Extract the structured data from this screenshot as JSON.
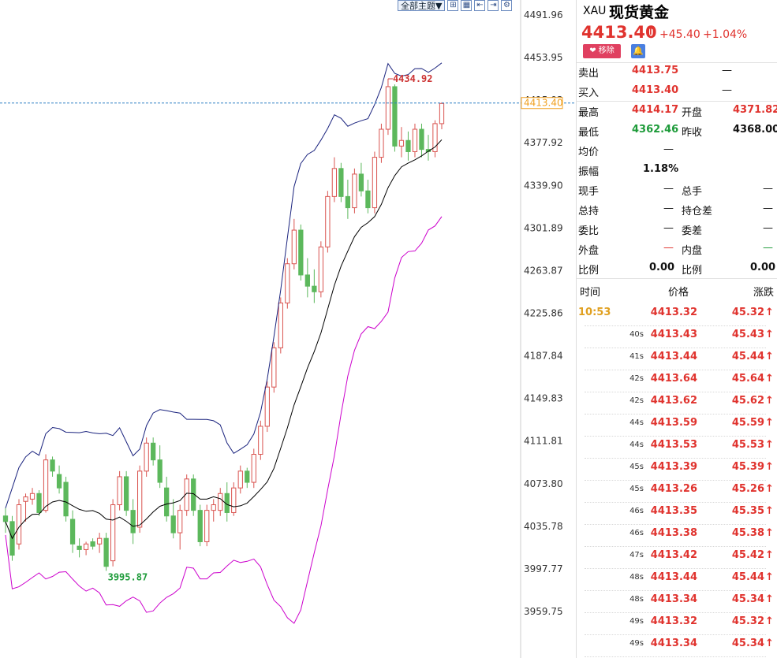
{
  "toolbar": {
    "theme_label": "全部主题▼",
    "icons": [
      "grid-icon",
      "table-icon",
      "first-page-icon",
      "last-page-icon",
      "settings-icon"
    ]
  },
  "header": {
    "code": "XAU",
    "name": "现货黄金",
    "price": "4413.40",
    "change": "+45.40",
    "change_pct": "+1.04%",
    "remove_label": "❤ 移除",
    "up_color": "#e0332e",
    "down_color": "#1e9b3a"
  },
  "quote": {
    "sell_label": "卖出",
    "sell": "4413.75",
    "sell_vol": "—",
    "buy_label": "买入",
    "buy": "4413.40",
    "buy_vol": "—",
    "high_label": "最高",
    "high": "4414.17",
    "open_label": "开盘",
    "open": "4371.82",
    "low_label": "最低",
    "low": "4362.46",
    "prev_label": "昨收",
    "prev": "4368.00",
    "avg_label": "均价",
    "avg": "—",
    "amp_label": "振幅",
    "amp": "1.18%",
    "cur_vol_label": "现手",
    "cur_vol": "—",
    "total_vol_label": "总手",
    "total_vol": "—",
    "oi_label": "总持",
    "oi": "—",
    "oi_diff_label": "持仓差",
    "oi_diff": "—",
    "ratio_label": "委比",
    "ratio": "—",
    "diff_label": "委差",
    "diff": "—",
    "outer_label": "外盘",
    "outer": "—",
    "inner_label": "内盘",
    "inner": "—",
    "ratio1_label": "比例",
    "ratio1": "0.00",
    "ratio2_label": "比例",
    "ratio2": "0.00"
  },
  "ticks": {
    "headers": [
      "时间",
      "价格",
      "涨跌"
    ],
    "rows": [
      {
        "time": "10:53",
        "price": "4413.32",
        "chg": "45.32"
      },
      {
        "time": "40s",
        "price": "4413.43",
        "chg": "45.43"
      },
      {
        "time": "41s",
        "price": "4413.44",
        "chg": "45.44"
      },
      {
        "time": "42s",
        "price": "4413.64",
        "chg": "45.64"
      },
      {
        "time": "42s",
        "price": "4413.62",
        "chg": "45.62"
      },
      {
        "time": "44s",
        "price": "4413.59",
        "chg": "45.59"
      },
      {
        "time": "44s",
        "price": "4413.53",
        "chg": "45.53"
      },
      {
        "time": "45s",
        "price": "4413.39",
        "chg": "45.39"
      },
      {
        "time": "45s",
        "price": "4413.26",
        "chg": "45.26"
      },
      {
        "time": "46s",
        "price": "4413.35",
        "chg": "45.35"
      },
      {
        "time": "46s",
        "price": "4413.38",
        "chg": "45.38"
      },
      {
        "time": "47s",
        "price": "4413.42",
        "chg": "45.42"
      },
      {
        "time": "48s",
        "price": "4413.44",
        "chg": "45.44"
      },
      {
        "time": "48s",
        "price": "4413.34",
        "chg": "45.34"
      },
      {
        "time": "49s",
        "price": "4413.32",
        "chg": "45.32"
      },
      {
        "time": "49s",
        "price": "4413.34",
        "chg": "45.34"
      }
    ]
  },
  "chart_data": {
    "type": "candlestick",
    "y_ticks": [
      "4491.96",
      "4453.95",
      "4415.93",
      "4377.92",
      "4339.90",
      "4301.89",
      "4263.87",
      "4225.86",
      "4187.84",
      "4149.83",
      "4111.81",
      "4073.80",
      "4035.78",
      "3997.77",
      "3959.75"
    ],
    "ylim": [
      3959.75,
      4491.96
    ],
    "current_price": "4413.40",
    "high_label": "4434.92",
    "low_label": "3995.87",
    "colors": {
      "up": "#d9534f",
      "down": "#5cb85c",
      "mid_band": "#000000",
      "upper_band": "#1a237e",
      "lower_band": "#cc00cc"
    },
    "candles": [
      [
        4045,
        4052,
        4030,
        4040
      ],
      [
        4040,
        4045,
        4005,
        4010
      ],
      [
        4020,
        4060,
        4015,
        4055
      ],
      [
        4058,
        4065,
        4040,
        4062
      ],
      [
        4060,
        4070,
        4055,
        4065
      ],
      [
        4065,
        4068,
        4045,
        4048
      ],
      [
        4050,
        4100,
        4048,
        4095
      ],
      [
        4095,
        4098,
        4080,
        4085
      ],
      [
        4082,
        4090,
        4065,
        4070
      ],
      [
        4075,
        4080,
        4040,
        4045
      ],
      [
        4042,
        4050,
        4012,
        4020
      ],
      [
        4018,
        4025,
        4008,
        4015
      ],
      [
        4015,
        4022,
        4010,
        4020
      ],
      [
        4022,
        4025,
        4015,
        4018
      ],
      [
        4020,
        4030,
        4012,
        4025
      ],
      [
        4025,
        4030,
        3996,
        4000
      ],
      [
        4005,
        4060,
        4000,
        4055
      ],
      [
        4055,
        4085,
        4050,
        4080
      ],
      [
        4080,
        4085,
        4045,
        4050
      ],
      [
        4050,
        4060,
        4020,
        4030
      ],
      [
        4035,
        4090,
        4030,
        4085
      ],
      [
        4085,
        4115,
        4080,
        4110
      ],
      [
        4110,
        4115,
        4090,
        4095
      ],
      [
        4095,
        4108,
        4070,
        4075
      ],
      [
        4070,
        4080,
        4040,
        4045
      ],
      [
        4045,
        4060,
        4025,
        4030
      ],
      [
        4030,
        4055,
        4015,
        4050
      ],
      [
        4050,
        4082,
        4045,
        4078
      ],
      [
        4078,
        4082,
        4045,
        4050
      ],
      [
        4050,
        4055,
        4018,
        4022
      ],
      [
        4022,
        4055,
        4018,
        4050
      ],
      [
        4050,
        4060,
        4040,
        4055
      ],
      [
        4050,
        4070,
        4045,
        4065
      ],
      [
        4065,
        4075,
        4040,
        4048
      ],
      [
        4048,
        4075,
        4045,
        4070
      ],
      [
        4070,
        4090,
        4065,
        4085
      ],
      [
        4085,
        4088,
        4070,
        4075
      ],
      [
        4075,
        4105,
        4070,
        4100
      ],
      [
        4100,
        4130,
        4095,
        4125
      ],
      [
        4125,
        4165,
        4120,
        4160
      ],
      [
        4160,
        4200,
        4155,
        4195
      ],
      [
        4195,
        4240,
        4190,
        4235
      ],
      [
        4235,
        4275,
        4230,
        4270
      ],
      [
        4270,
        4310,
        4265,
        4300
      ],
      [
        4300,
        4305,
        4255,
        4260
      ],
      [
        4260,
        4275,
        4240,
        4250
      ],
      [
        4250,
        4265,
        4235,
        4245
      ],
      [
        4245,
        4290,
        4240,
        4285
      ],
      [
        4285,
        4335,
        4280,
        4330
      ],
      [
        4330,
        4365,
        4325,
        4355
      ],
      [
        4355,
        4360,
        4325,
        4330
      ],
      [
        4330,
        4345,
        4310,
        4320
      ],
      [
        4320,
        4355,
        4315,
        4350
      ],
      [
        4350,
        4360,
        4330,
        4335
      ],
      [
        4335,
        4345,
        4315,
        4320
      ],
      [
        4320,
        4370,
        4315,
        4365
      ],
      [
        4365,
        4395,
        4360,
        4390
      ],
      [
        4390,
        4435,
        4385,
        4428
      ],
      [
        4428,
        4430,
        4370,
        4375
      ],
      [
        4375,
        4392,
        4365,
        4380
      ],
      [
        4380,
        4388,
        4362,
        4370
      ],
      [
        4370,
        4395,
        4365,
        4390
      ],
      [
        4390,
        4395,
        4365,
        4372
      ],
      [
        4372,
        4385,
        4362,
        4370
      ],
      [
        4370,
        4398,
        4365,
        4395
      ],
      [
        4395,
        4414,
        4390,
        4413
      ]
    ]
  }
}
